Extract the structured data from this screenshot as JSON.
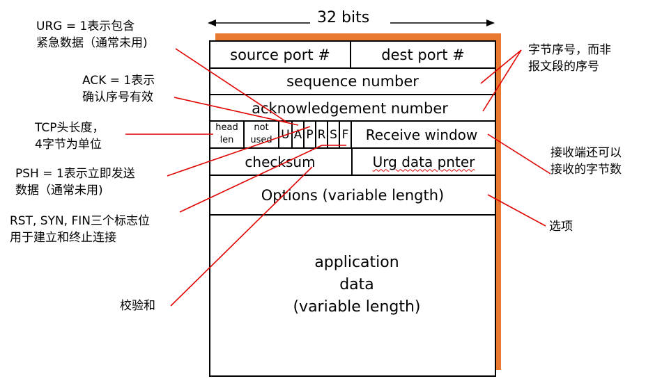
{
  "width_label": "32 bits",
  "fields": {
    "source_port": "source port #",
    "dest_port": "dest port #",
    "sequence_number": "sequence number",
    "ack_number": "acknowledgement number",
    "head_len_1": "head",
    "head_len_2": "len",
    "not_used_1": "not",
    "not_used_2": "used",
    "flag_u": "U",
    "flag_a": "A",
    "flag_p": "P",
    "flag_r": "R",
    "flag_s": "S",
    "flag_f": "F",
    "receive_window": "Receive window",
    "checksum": "checksum",
    "urg_pointer": "Urg data pnter",
    "options": "Options (variable length)",
    "app_data_1": "application",
    "app_data_2": "data",
    "app_data_3": "(variable length)"
  },
  "annotations": {
    "urg": [
      "URG = 1表示包含",
      "紧急数据（通常未用)"
    ],
    "ack": [
      "ACK = 1表示",
      "确认序号有效"
    ],
    "header_len": [
      "TCP头长度，",
      "4字节为单位"
    ],
    "psh": [
      "PSH = 1表示立即发送",
      "数据（通常未用)"
    ],
    "rst_syn_fin": [
      "RST, SYN, FIN三个标志位",
      "用于建立和终止连接"
    ],
    "checksum": [
      "校验和"
    ],
    "seq_byte": [
      "字节序号，而非",
      "报文段的序号"
    ],
    "recv_window": [
      "接收端还可以",
      "接收的字节数"
    ],
    "options": [
      "选项"
    ]
  },
  "colors": {
    "shadow": "#E8782F",
    "lines": "#E00000"
  }
}
